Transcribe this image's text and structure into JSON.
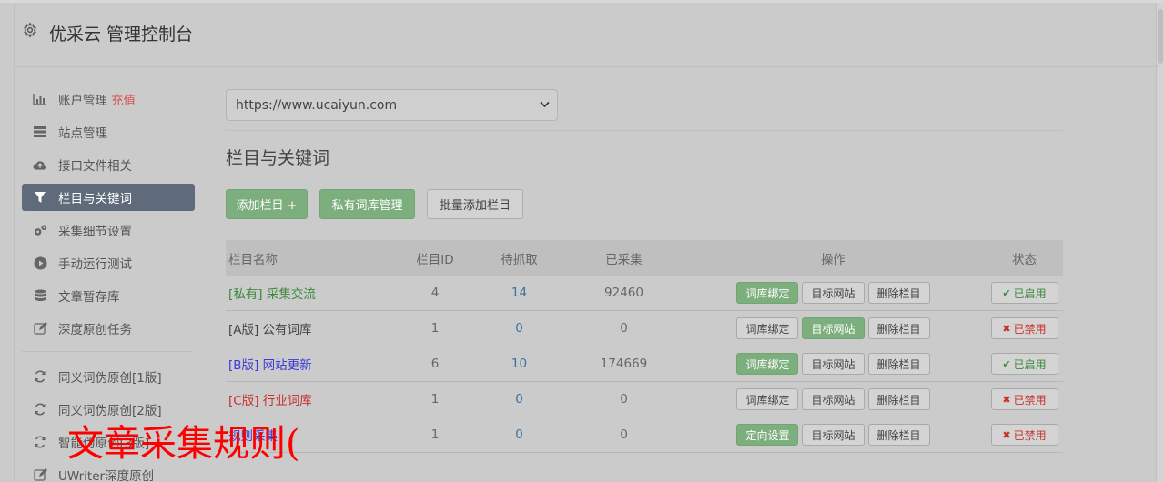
{
  "header": {
    "title": "优采云 管理控制台",
    "icon": "gear-icon"
  },
  "sidebar": {
    "items": [
      {
        "label": "账户管理",
        "extra": "充值",
        "icon": "bar-chart-icon"
      },
      {
        "label": "站点管理",
        "icon": "server-icon"
      },
      {
        "label": "接口文件相关",
        "icon": "cloud-upload-icon"
      },
      {
        "label": "栏目与关键词",
        "icon": "filter-icon",
        "active": true
      },
      {
        "label": "采集细节设置",
        "icon": "cogs-icon"
      },
      {
        "label": "手动运行测试",
        "icon": "play-circle-icon"
      },
      {
        "label": "文章暂存库",
        "icon": "database-icon"
      },
      {
        "label": "深度原创任务",
        "icon": "edit-icon"
      }
    ],
    "items2": [
      {
        "label": "同义词伪原创[1版]",
        "icon": "refresh-icon"
      },
      {
        "label": "同义词伪原创[2版]",
        "icon": "refresh-icon"
      },
      {
        "label": "智能伪原创[3版]",
        "icon": "refresh-icon"
      },
      {
        "label": "UWriter深度原创",
        "icon": "edit-icon"
      }
    ]
  },
  "overlay_text": "文章采集规则(",
  "main": {
    "site_select": "https://www.ucaiyun.com",
    "section_title": "栏目与关键词",
    "buttons": {
      "add": "添加栏目 +",
      "private_lib": "私有词库管理",
      "batch_add": "批量添加栏目"
    },
    "table": {
      "headers": {
        "name": "栏目名称",
        "id": "栏目ID",
        "wait": "待抓取",
        "done": "已采集",
        "ops": "操作",
        "state": "状态"
      },
      "rows": [
        {
          "name": "[私有] 采集交流",
          "name_color": "#3c8a3c",
          "id": "4",
          "wait": "14",
          "done": "92460",
          "op1": "词库绑定",
          "op1_green": true,
          "op2": "目标网站",
          "op2_green": false,
          "op3": "删除栏目",
          "state": "已启用",
          "enabled": true
        },
        {
          "name": "[A版] 公有词库",
          "name_color": "#444444",
          "id": "1",
          "wait": "0",
          "done": "0",
          "op1": "词库绑定",
          "op1_green": false,
          "op2": "目标网站",
          "op2_green": true,
          "op3": "删除栏目",
          "state": "已禁用",
          "enabled": false
        },
        {
          "name": "[B版] 网站更新",
          "name_color": "#3b3bd6",
          "id": "6",
          "wait": "10",
          "done": "174669",
          "op1": "词库绑定",
          "op1_green": true,
          "op2": "目标网站",
          "op2_green": false,
          "op3": "删除栏目",
          "state": "已启用",
          "enabled": true
        },
        {
          "name": "[C版] 行业词库",
          "name_color": "#c9302c",
          "id": "1",
          "wait": "0",
          "done": "0",
          "op1": "词库绑定",
          "op1_green": false,
          "op2": "目标网站",
          "op2_green": false,
          "op3": "删除栏目",
          "state": "已禁用",
          "enabled": false
        },
        {
          "name": "规则采集",
          "name_color": "#3b3bd6",
          "id": "1",
          "wait": "0",
          "done": "0",
          "op1": "定向设置",
          "op1_green": true,
          "op2": "目标网站",
          "op2_green": false,
          "op3": "删除栏目",
          "state": "已禁用",
          "enabled": false
        }
      ]
    }
  }
}
